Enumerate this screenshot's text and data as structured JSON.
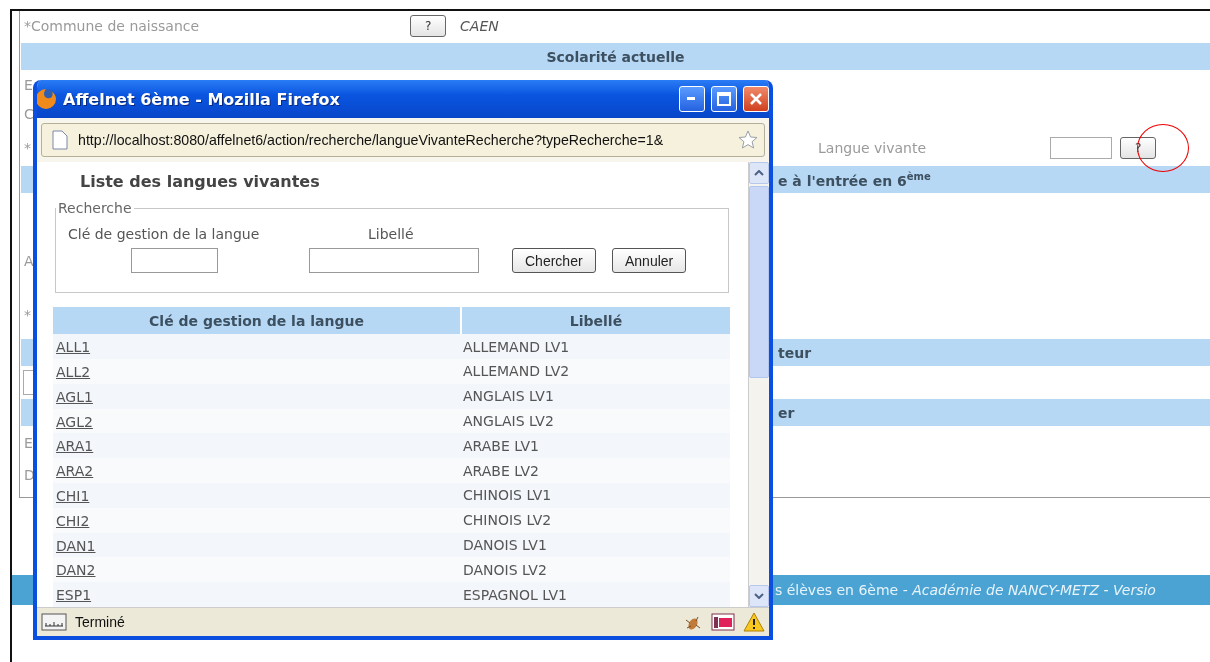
{
  "background": {
    "birth_commune": {
      "label": "*Commune de naissance",
      "button": "?",
      "value": "CAEN"
    },
    "section_current": {
      "title": "Scolarité actuelle"
    },
    "partial_labels_top": [
      "E",
      "C",
      "*"
    ],
    "language_field": {
      "label": "Langue vivante",
      "button": "?",
      "highlighted": true
    },
    "section_entry": {
      "title": "e à l'entrée en 6$^{ème}$"
    },
    "partial_labels_middle": [
      "A",
      "*"
    ],
    "section_third": {
      "title": "teur"
    },
    "section_fourth": {
      "title": "er"
    },
    "partial_labels_bottom": [
      "E",
      "D"
    ],
    "footer": {
      "text": "s élèves en 6ème - *Académie de NANCY-METZ - Versio*"
    }
  },
  "popup": {
    "title": "Affelnet 6ème - Mozilla Firefox",
    "url": "http://localhost:8080/affelnet6/action/recherche/langueVivanteRecherche?typeRecherche=1&",
    "heading": "Liste des langues vivantes",
    "search": {
      "legend": "Recherche",
      "fields": [
        {
          "label": "Clé de gestion de la langue"
        },
        {
          "label": "Libellé"
        }
      ],
      "buttons": [
        "Chercher",
        "Annuler"
      ]
    },
    "table": {
      "columns": [
        "Clé de gestion de la langue",
        "Libellé"
      ],
      "rows": [
        {
          "key": "ALL1",
          "label": "ALLEMAND LV1"
        },
        {
          "key": "ALL2",
          "label": "ALLEMAND LV2"
        },
        {
          "key": "AGL1",
          "label": "ANGLAIS LV1"
        },
        {
          "key": "AGL2",
          "label": "ANGLAIS LV2"
        },
        {
          "key": "ARA1",
          "label": "ARABE LV1"
        },
        {
          "key": "ARA2",
          "label": "ARABE LV2"
        },
        {
          "key": "CHI1",
          "label": "CHINOIS LV1"
        },
        {
          "key": "CHI2",
          "label": "CHINOIS LV2"
        },
        {
          "key": "DAN1",
          "label": "DANOIS LV1"
        },
        {
          "key": "DAN2",
          "label": "DANOIS LV2"
        },
        {
          "key": "ESP1",
          "label": "ESPAGNOL LV1"
        }
      ]
    },
    "status": "Terminé"
  }
}
